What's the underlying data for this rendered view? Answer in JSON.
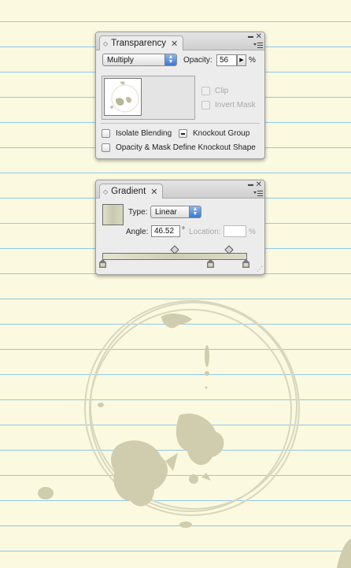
{
  "transparency_panel": {
    "tab_title": "Transparency",
    "blend_mode": "Multiply",
    "opacity_label": "Opacity:",
    "opacity_value": "56",
    "percent": "%",
    "clip_label": "Clip",
    "invert_mask_label": "Invert Mask",
    "isolate_blending_label": "Isolate Blending",
    "knockout_group_label": "Knockout Group",
    "opacity_mask_label": "Opacity & Mask Define Knockout Shape",
    "knockout_group_state": "mixed"
  },
  "gradient_panel": {
    "tab_title": "Gradient",
    "type_label": "Type:",
    "type_value": "Linear",
    "angle_label": "Angle:",
    "angle_value": "46.52",
    "degree_symbol": "°",
    "location_label": "Location:",
    "location_value": "",
    "percent": "%",
    "stops": [
      0,
      0.75,
      1
    ],
    "midpoints": [
      0.5,
      0.88
    ]
  },
  "icons": {
    "tab_diamond": "◇",
    "tab_close": "✕",
    "collapse": "▬",
    "close": "✕",
    "panel_menu": "panel-menu-icon"
  },
  "colors": {
    "paper": "#fbf9df",
    "rule_lines": "#8fc8ea",
    "stain": "#c9c7a6",
    "select_accent": "#3c78cf"
  }
}
